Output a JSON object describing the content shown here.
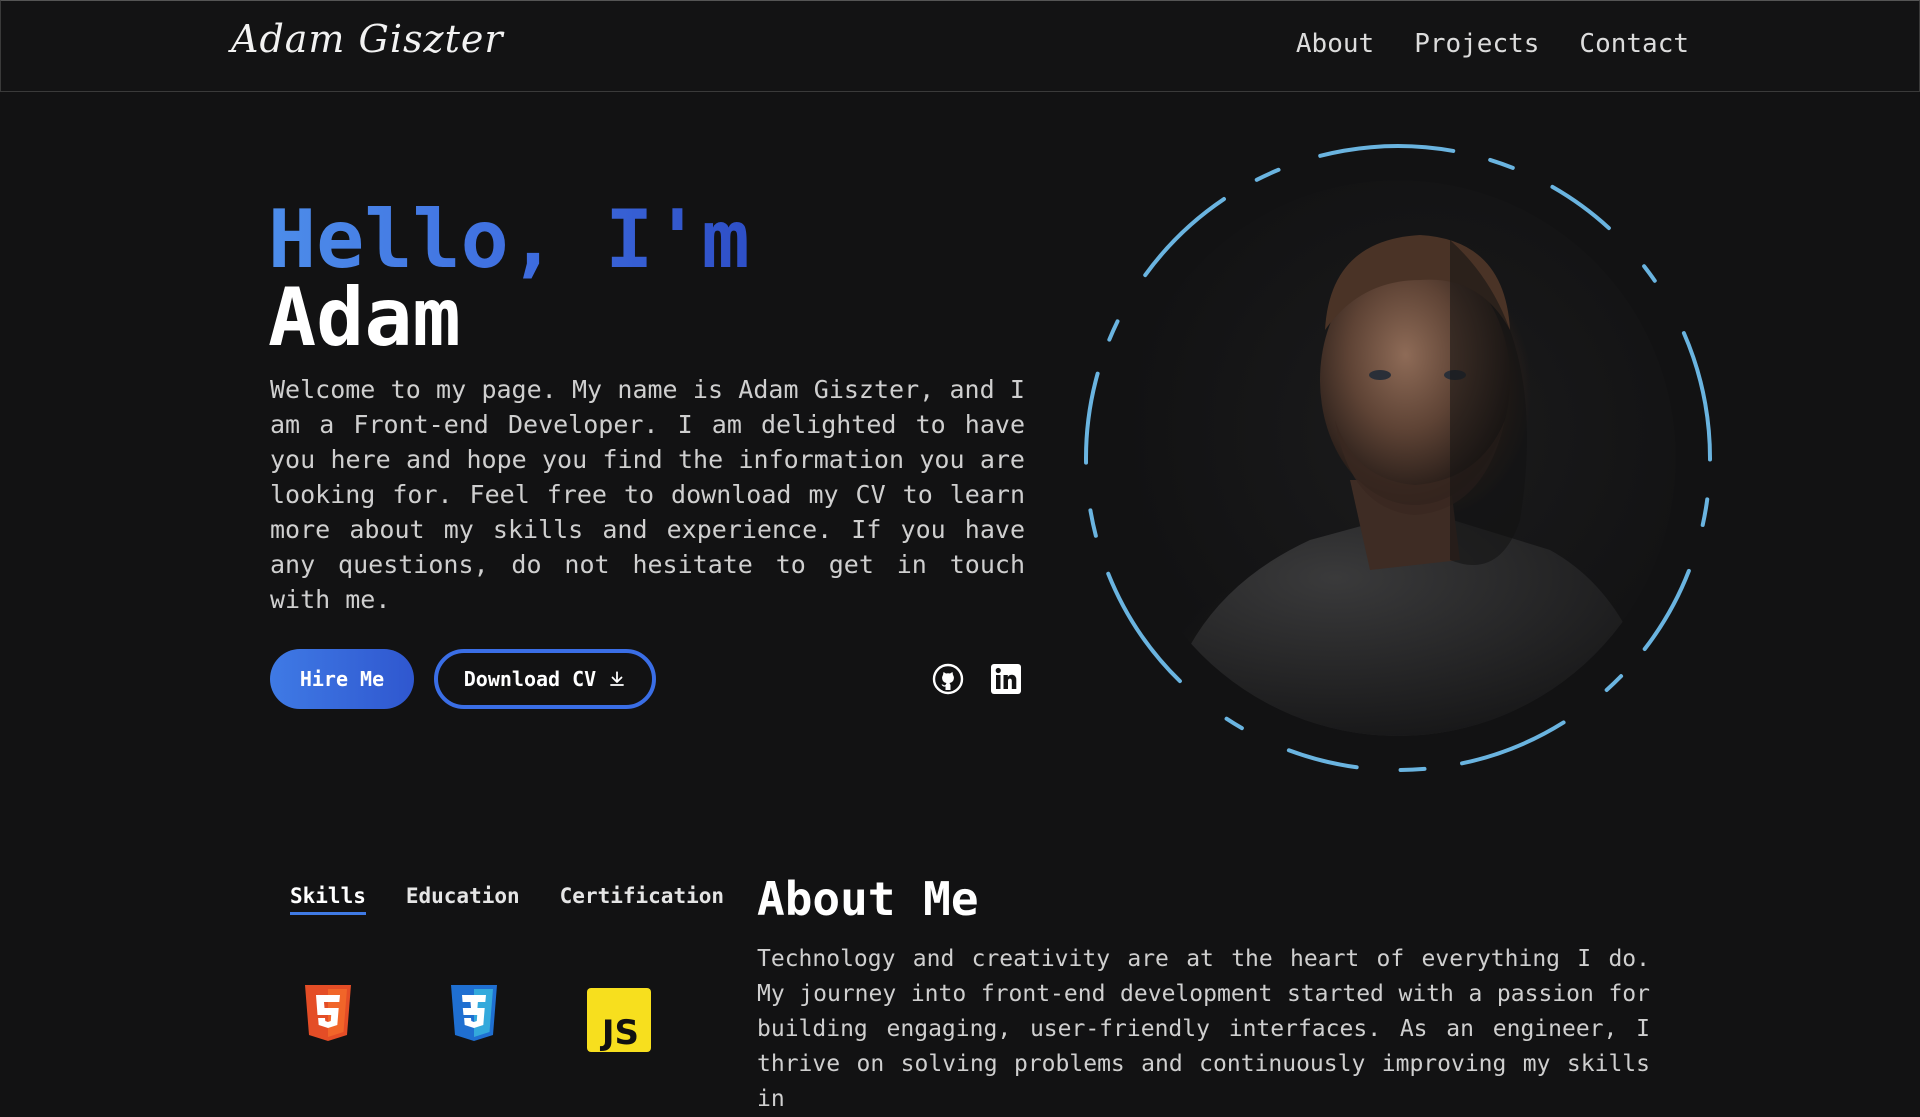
{
  "header": {
    "logo": "Adam Giszter",
    "nav": [
      "About",
      "Projects",
      "Contact"
    ]
  },
  "hero": {
    "greeting": "Hello, I'm",
    "name": "Adam",
    "intro": "Welcome to my page. My name is Adam Giszter, and I am a Front-end Developer. I am delighted to have you here and hope you find the information you are looking for. Feel free to download my CV to learn more about my skills and experience. If you have any questions, do not hesitate to get in touch with me.",
    "hire_label": "Hire Me",
    "cv_label": "Download CV",
    "social": [
      "github-icon",
      "linkedin-icon"
    ]
  },
  "tabs": {
    "items": [
      "Skills",
      "Education",
      "Certification"
    ],
    "active": "Skills"
  },
  "skills": [
    "html5-icon",
    "css3-icon",
    "javascript-icon"
  ],
  "skill_labels": {
    "js": "JS"
  },
  "about": {
    "title": "About Me",
    "text": "Technology and creativity are at the heart of everything I do. My journey into front-end development started with a passion for building engaging, user-friendly interfaces. As an engineer, I thrive on solving problems and continuously improving my skills in"
  },
  "colors": {
    "accent": "#3f7ae5",
    "ring": "#6ab4e0",
    "background": "#121213",
    "html5": "#e44d26",
    "css3": "#1f6fd1",
    "js": "#f7df1e"
  }
}
